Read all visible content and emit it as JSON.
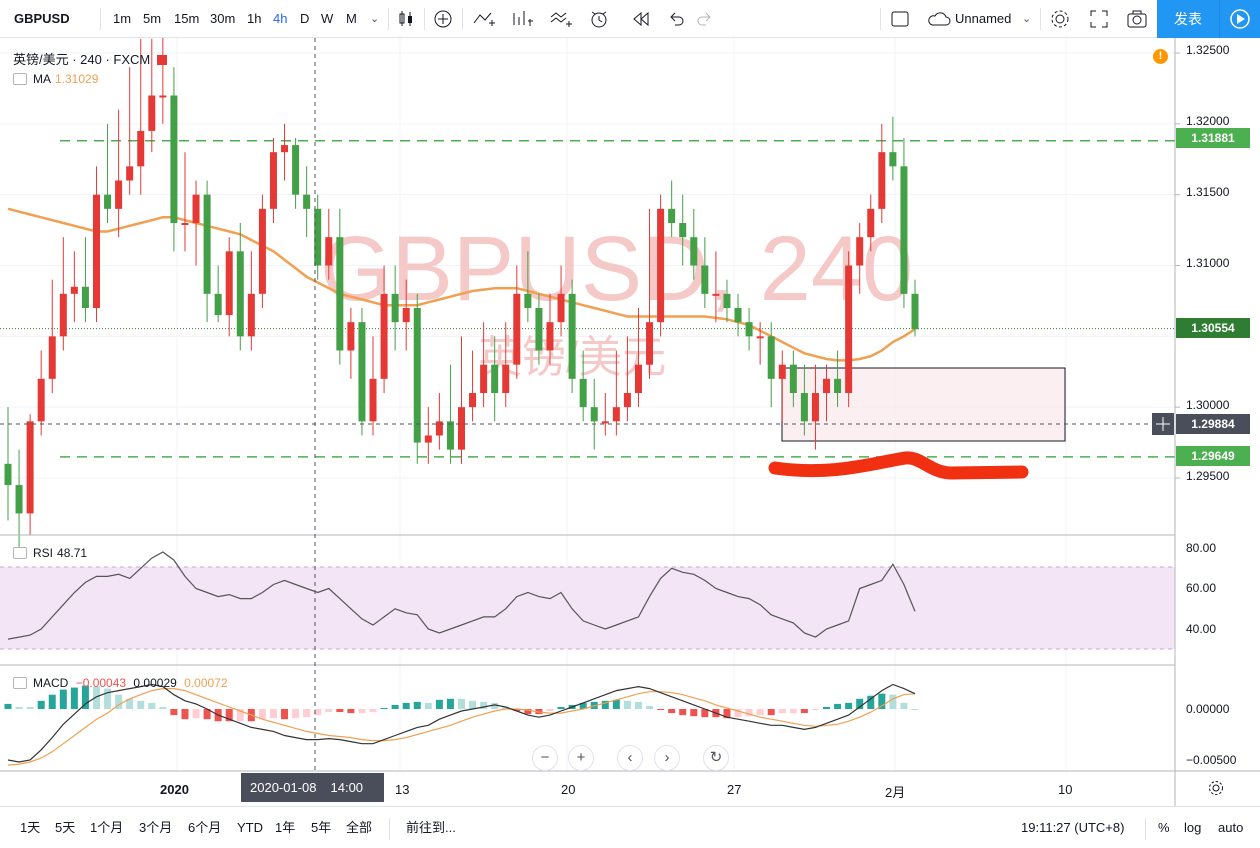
{
  "toolbar": {
    "symbol": "GBPUSD",
    "intervals": [
      "1m",
      "5m",
      "15m",
      "30m",
      "1h",
      "4h",
      "D",
      "W",
      "M"
    ],
    "active_interval": "4h",
    "layout_name": "Unnamed",
    "publish_label": "发表"
  },
  "legend": {
    "title": "英镑/美元 · 240 · FXCM",
    "ma_label": "MA",
    "ma_value": "1.31029",
    "rsi_label": "RSI",
    "rsi_value": "48.71",
    "macd_label": "MACD",
    "macd_v1": "−0.00043",
    "macd_v2": "0.00029",
    "macd_v3": "0.00072"
  },
  "price_axis": {
    "ticks": [
      "1.32500",
      "1.32000",
      "1.31500",
      "1.31000",
      "1.30000",
      "1.29500"
    ],
    "tags": [
      {
        "label": "1.31881",
        "color": "#4caf50"
      },
      {
        "label": "1.30554",
        "color": "#2e7d32"
      },
      {
        "label": "1.29884",
        "color": "#4a4e5a"
      },
      {
        "label": "1.29649",
        "color": "#4caf50"
      }
    ]
  },
  "rsi_axis": {
    "ticks": [
      "80.00",
      "60.00",
      "40.00"
    ]
  },
  "macd_axis": {
    "ticks": [
      "0.00000",
      "−0.00500"
    ]
  },
  "time_axis": {
    "labels": [
      "2020",
      "13",
      "20",
      "27",
      "2月",
      "10"
    ],
    "crosshair_date": "2020-01-08",
    "crosshair_time": "14:00"
  },
  "watermark": {
    "main": "GBPUSD, 240",
    "sub": "英镑/美元"
  },
  "bottom": {
    "ranges": [
      "1天",
      "5天",
      "1个月",
      "3个月",
      "6个月",
      "YTD",
      "1年",
      "5年",
      "全部"
    ],
    "goto": "前往到...",
    "clock": "19:11:27 (UTC+8)",
    "pct": "%",
    "log": "log",
    "auto": "auto"
  },
  "alert_badge": "!",
  "colors": {
    "up": "#e53935",
    "down": "#43a047",
    "ma": "#f0a050",
    "rsi_band": "#f3e5f5",
    "hline": "#4caf50",
    "red_marker": "#f03010"
  },
  "chart_data": {
    "type": "candlestick",
    "symbol": "GBPUSD",
    "interval": "240",
    "series_price": {
      "open": [
        1.296,
        1.2945,
        1.2925,
        1.299,
        1.302,
        1.305,
        1.308,
        1.3085,
        1.307,
        1.315,
        1.314,
        1.316,
        1.317,
        1.3195,
        1.322,
        1.322,
        1.313,
        1.313,
        1.315,
        1.308,
        1.3065,
        1.311,
        1.305,
        1.308,
        1.314,
        1.318,
        1.3185,
        1.315,
        1.314,
        1.31,
        1.312,
        1.304,
        1.306,
        1.299,
        1.302,
        1.308,
        1.306,
        1.307,
        1.2975,
        1.298,
        1.299,
        1.297,
        1.3,
        1.301,
        1.303,
        1.301,
        1.303,
        1.308,
        1.307,
        1.304,
        1.306,
        1.308,
        1.302,
        1.3,
        1.299,
        1.299,
        1.3,
        1.301,
        1.303,
        1.306,
        1.314,
        1.313,
        1.312,
        1.31,
        1.308,
        1.308,
        1.307,
        1.306,
        1.305,
        1.305,
        1.302,
        1.303,
        1.301,
        1.299,
        1.301,
        1.302,
        1.301,
        1.31,
        1.312,
        1.314,
        1.318,
        1.317,
        1.308
      ],
      "high": [
        1.3,
        1.297,
        1.2995,
        1.304,
        1.309,
        1.312,
        1.311,
        1.312,
        1.317,
        1.32,
        1.321,
        1.324,
        1.326,
        1.326,
        1.327,
        1.324,
        1.318,
        1.316,
        1.316,
        1.31,
        1.312,
        1.313,
        1.311,
        1.315,
        1.319,
        1.32,
        1.319,
        1.317,
        1.315,
        1.314,
        1.314,
        1.307,
        1.307,
        1.305,
        1.31,
        1.31,
        1.309,
        1.308,
        1.3,
        1.301,
        1.303,
        1.305,
        1.304,
        1.306,
        1.305,
        1.306,
        1.31,
        1.311,
        1.308,
        1.308,
        1.31,
        1.309,
        1.304,
        1.302,
        1.301,
        1.304,
        1.305,
        1.307,
        1.314,
        1.315,
        1.316,
        1.315,
        1.314,
        1.312,
        1.311,
        1.309,
        1.308,
        1.307,
        1.306,
        1.306,
        1.304,
        1.304,
        1.303,
        1.303,
        1.303,
        1.304,
        1.311,
        1.313,
        1.315,
        1.32,
        1.3205,
        1.319,
        1.309
      ],
      "low": [
        1.292,
        1.29,
        1.291,
        1.298,
        1.301,
        1.304,
        1.306,
        1.306,
        1.306,
        1.313,
        1.312,
        1.315,
        1.315,
        1.318,
        1.32,
        1.311,
        1.311,
        1.31,
        1.306,
        1.306,
        1.305,
        1.304,
        1.304,
        1.307,
        1.313,
        1.316,
        1.314,
        1.312,
        1.309,
        1.309,
        1.303,
        1.302,
        1.298,
        1.298,
        1.301,
        1.304,
        1.304,
        1.296,
        1.296,
        1.297,
        1.296,
        1.296,
        1.299,
        1.3,
        1.299,
        1.3,
        1.302,
        1.306,
        1.303,
        1.303,
        1.305,
        1.301,
        1.299,
        1.297,
        1.298,
        1.298,
        1.299,
        1.3,
        1.302,
        1.305,
        1.312,
        1.31,
        1.309,
        1.307,
        1.306,
        1.306,
        1.305,
        1.304,
        1.303,
        1.3,
        1.299,
        1.3,
        1.298,
        1.297,
        1.299,
        1.3,
        1.3,
        1.308,
        1.311,
        1.313,
        1.316,
        1.307,
        1.305
      ],
      "close": [
        1.2945,
        1.2925,
        1.299,
        1.302,
        1.305,
        1.308,
        1.3085,
        1.307,
        1.315,
        1.314,
        1.316,
        1.317,
        1.3195,
        1.322,
        1.322,
        1.313,
        1.313,
        1.315,
        1.308,
        1.3065,
        1.311,
        1.305,
        1.308,
        1.314,
        1.318,
        1.3185,
        1.315,
        1.314,
        1.31,
        1.312,
        1.304,
        1.306,
        1.299,
        1.302,
        1.308,
        1.306,
        1.307,
        1.2975,
        1.298,
        1.299,
        1.297,
        1.3,
        1.301,
        1.303,
        1.301,
        1.303,
        1.308,
        1.307,
        1.304,
        1.306,
        1.308,
        1.302,
        1.3,
        1.299,
        1.299,
        1.3,
        1.301,
        1.303,
        1.306,
        1.314,
        1.313,
        1.312,
        1.31,
        1.308,
        1.308,
        1.307,
        1.306,
        1.305,
        1.305,
        1.302,
        1.303,
        1.301,
        1.299,
        1.301,
        1.302,
        1.301,
        1.31,
        1.312,
        1.314,
        1.318,
        1.317,
        1.308,
        1.3055
      ]
    },
    "ma_values": [
      1.314,
      1.3138,
      1.3136,
      1.3134,
      1.3132,
      1.313,
      1.3128,
      1.3126,
      1.3124,
      1.3124,
      1.3126,
      1.3128,
      1.313,
      1.3132,
      1.3134,
      1.3134,
      1.3132,
      1.313,
      1.3128,
      1.3126,
      1.3124,
      1.3122,
      1.3118,
      1.3114,
      1.311,
      1.3104,
      1.3098,
      1.3092,
      1.3088,
      1.3084,
      1.308,
      1.3078,
      1.3076,
      1.3074,
      1.3072,
      1.3072,
      1.3072,
      1.3072,
      1.3074,
      1.3076,
      1.3078,
      1.308,
      1.3082,
      1.3083,
      1.3084,
      1.3084,
      1.3084,
      1.3082,
      1.308,
      1.3078,
      1.3076,
      1.3074,
      1.3072,
      1.307,
      1.3068,
      1.3066,
      1.3064,
      1.3064,
      1.3064,
      1.3064,
      1.3064,
      1.3064,
      1.3064,
      1.3064,
      1.3063,
      1.3062,
      1.306,
      1.3058,
      1.3054,
      1.305,
      1.3046,
      1.3042,
      1.3038,
      1.3036,
      1.3034,
      1.3033,
      1.3033,
      1.3034,
      1.3036,
      1.304,
      1.3046,
      1.305,
      1.3055
    ],
    "horizontal_levels": [
      1.31881,
      1.29649
    ],
    "last_price": 1.30554,
    "crosshair_price": 1.29884,
    "price_range": [
      1.292,
      1.326
    ],
    "rsi": {
      "range": [
        20,
        85
      ],
      "band": [
        30,
        70
      ],
      "values": [
        35,
        36,
        37,
        40,
        46,
        52,
        58,
        63,
        66,
        66,
        67,
        65,
        70,
        75,
        78,
        74,
        66,
        60,
        58,
        56,
        57,
        55,
        55,
        58,
        62,
        64,
        62,
        60,
        58,
        60,
        55,
        50,
        45,
        42,
        46,
        50,
        48,
        47,
        40,
        38,
        40,
        42,
        44,
        46,
        46,
        50,
        56,
        58,
        56,
        55,
        58,
        50,
        44,
        42,
        40,
        42,
        44,
        46,
        56,
        65,
        70,
        68,
        67,
        64,
        60,
        58,
        56,
        55,
        52,
        47,
        45,
        43,
        38,
        36,
        40,
        42,
        44,
        60,
        62,
        64,
        72,
        62,
        48.71
      ]
    },
    "macd": {
      "range": [
        -0.006,
        0.003
      ],
      "macd_line": [
        -0.005,
        -0.0052,
        -0.005,
        -0.004,
        -0.0028,
        -0.0015,
        -0.0005,
        0.0005,
        0.0012,
        0.0016,
        0.0018,
        0.002,
        0.0022,
        0.0024,
        0.0022,
        0.0014,
        0.0008,
        0.0005,
        0.0,
        -0.0006,
        -0.001,
        -0.0014,
        -0.0018,
        -0.002,
        -0.0022,
        -0.0026,
        -0.0028,
        -0.003,
        -0.003,
        -0.0029,
        -0.003,
        -0.0032,
        -0.0034,
        -0.0034,
        -0.003,
        -0.0026,
        -0.0022,
        -0.0018,
        -0.0016,
        -0.001,
        -0.0006,
        -0.0002,
        0.0,
        0.0002,
        0.0004,
        0.0002,
        -0.0002,
        -0.0006,
        -0.0008,
        -0.0006,
        -0.0002,
        0.0002,
        0.0006,
        0.001,
        0.0014,
        0.0018,
        0.002,
        0.0022,
        0.002,
        0.0016,
        0.0012,
        0.0008,
        0.0004,
        0.0,
        -0.0004,
        -0.0008,
        -0.001,
        -0.0012,
        -0.0014,
        -0.0016,
        -0.0016,
        -0.0018,
        -0.002,
        -0.0018,
        -0.0014,
        -0.001,
        -0.0006,
        0.0002,
        0.001,
        0.0018,
        0.0024,
        0.002,
        0.0015
      ],
      "signal_line": [
        -0.0055,
        -0.0054,
        -0.0052,
        -0.0048,
        -0.0042,
        -0.0034,
        -0.0026,
        -0.0018,
        -0.001,
        -0.0004,
        0.0004,
        0.001,
        0.0014,
        0.0018,
        0.002,
        0.002,
        0.0018,
        0.0014,
        0.001,
        0.0006,
        0.0002,
        -0.0002,
        -0.0006,
        -0.001,
        -0.0013,
        -0.0016,
        -0.0019,
        -0.0022,
        -0.0024,
        -0.0026,
        -0.0027,
        -0.0028,
        -0.003,
        -0.0031,
        -0.0031,
        -0.003,
        -0.0028,
        -0.0025,
        -0.0022,
        -0.0019,
        -0.0016,
        -0.0012,
        -0.0008,
        -0.0005,
        -0.0002,
        0.0,
        0.0,
        -0.0001,
        -0.0003,
        -0.0004,
        -0.0004,
        -0.0002,
        0.0,
        0.0003,
        0.0006,
        0.0009,
        0.0012,
        0.0015,
        0.0017,
        0.0017,
        0.0016,
        0.0014,
        0.0011,
        0.0008,
        0.0004,
        0.0001,
        -0.0002,
        -0.0005,
        -0.0008,
        -0.001,
        -0.0012,
        -0.0014,
        -0.0016,
        -0.0017,
        -0.0016,
        -0.0015,
        -0.0012,
        -0.0008,
        -0.0003,
        0.0003,
        0.001,
        0.0014,
        0.0015
      ]
    }
  }
}
